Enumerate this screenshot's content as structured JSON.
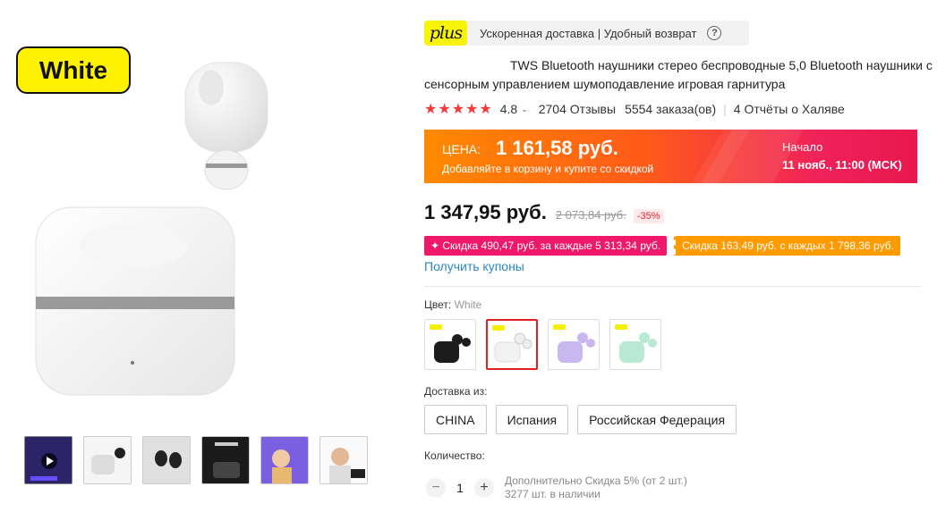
{
  "gallery": {
    "badge_label": "White"
  },
  "plus": {
    "logo_text": "plus",
    "text": "Ускоренная доставка | Удобный возврат",
    "help_symbol": "?"
  },
  "product": {
    "title": "TWS Bluetooth наушники стерео беспроводные 5,0 Bluetooth наушники с сенсорным управлением шумоподавление игровая гарнитура"
  },
  "rating": {
    "stars": "★★★★★",
    "value": "4.8",
    "chevron": "⌄",
    "reviews": "2704 Отзывы",
    "orders": "5554 заказа(ов)",
    "separator": "|",
    "free_reports": "4 Отчёты о Халяве"
  },
  "promo": {
    "label": "ЦЕНА:",
    "price": "1 161,58 руб.",
    "subtitle": "Добавляйте в корзину и купите со скидкой",
    "start_label": "Начало",
    "start_date": "11 нояб., 11:00 (MCK)"
  },
  "price": {
    "current": "1 347,95 руб.",
    "old": "2 073,84 руб.",
    "discount": "-35%"
  },
  "coupons": {
    "pink": "✦ Скидка 490,47 руб. за каждые 5 313,34 руб.",
    "orange": "Скидка 163,49 руб. с каждых 1 798,36 руб.",
    "get_link": "Получить купоны"
  },
  "color": {
    "label": "Цвет: ",
    "value": "White",
    "options": [
      "Black",
      "White",
      "Purple",
      "Green"
    ]
  },
  "shipping": {
    "label": "Доставка из:",
    "options": [
      "CHINA",
      "Испания",
      "Российская Федерация"
    ]
  },
  "quantity": {
    "label": "Количество:",
    "minus": "−",
    "value": "1",
    "plus": "+",
    "extra_discount": "Дополнительно Скидка 5% (от 2 шт.)",
    "stock": "3277 шт. в наличии"
  },
  "colors": {
    "accent_red": "#f23a3a",
    "link_blue": "#2a86c8",
    "plus_yellow": "#f7f40a",
    "coupon_pink": "#f0186a",
    "coupon_orange": "#ff9a00"
  }
}
